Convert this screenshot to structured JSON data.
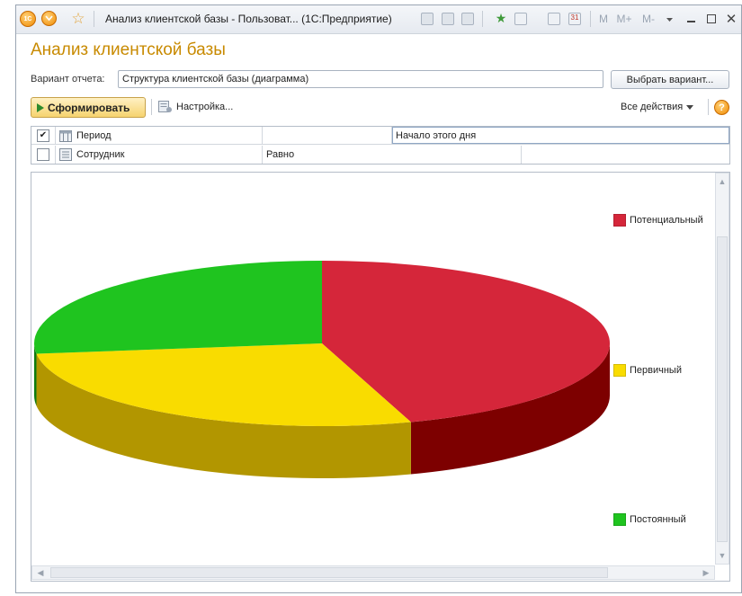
{
  "titlebar": {
    "title": "Анализ клиентской базы - Пользоват...  (1С:Предприятие)",
    "logo_text": "1С",
    "memory_buttons": [
      "M",
      "M+",
      "M-"
    ],
    "icons": [
      "back-icon",
      "star-icon",
      "save-icon",
      "print-icon",
      "preview-icon",
      "favorite-icon",
      "history-icon",
      "calculator-icon",
      "calendar-icon",
      "minimize-icon",
      "maximize-icon",
      "close-icon"
    ]
  },
  "page": {
    "heading": "Анализ клиентской базы",
    "variant_label": "Вариант отчета:",
    "variant_value": "Структура клиентской базы (диаграмма)",
    "choose_variant": "Выбрать вариант..."
  },
  "toolbar": {
    "generate": "Сформировать",
    "settings": "Настройка...",
    "all_actions": "Все действия",
    "help": "?"
  },
  "filters": [
    {
      "checked": true,
      "field": "Период",
      "condition": "",
      "value": "Начало этого дня"
    },
    {
      "checked": false,
      "field": "Сотрудник",
      "condition": "Равно",
      "value": ""
    }
  ],
  "chart_data": {
    "type": "pie",
    "style": "3d",
    "categories": [
      "Потенциальный",
      "Первичный",
      "Постоянный"
    ],
    "values": [
      45,
      28,
      27
    ],
    "colors": [
      "#d5263a",
      "#f9dc00",
      "#1fc41f"
    ],
    "side_colors": [
      "#7d0000",
      "#b29600",
      "#0e7a0e"
    ],
    "legend": "right"
  }
}
